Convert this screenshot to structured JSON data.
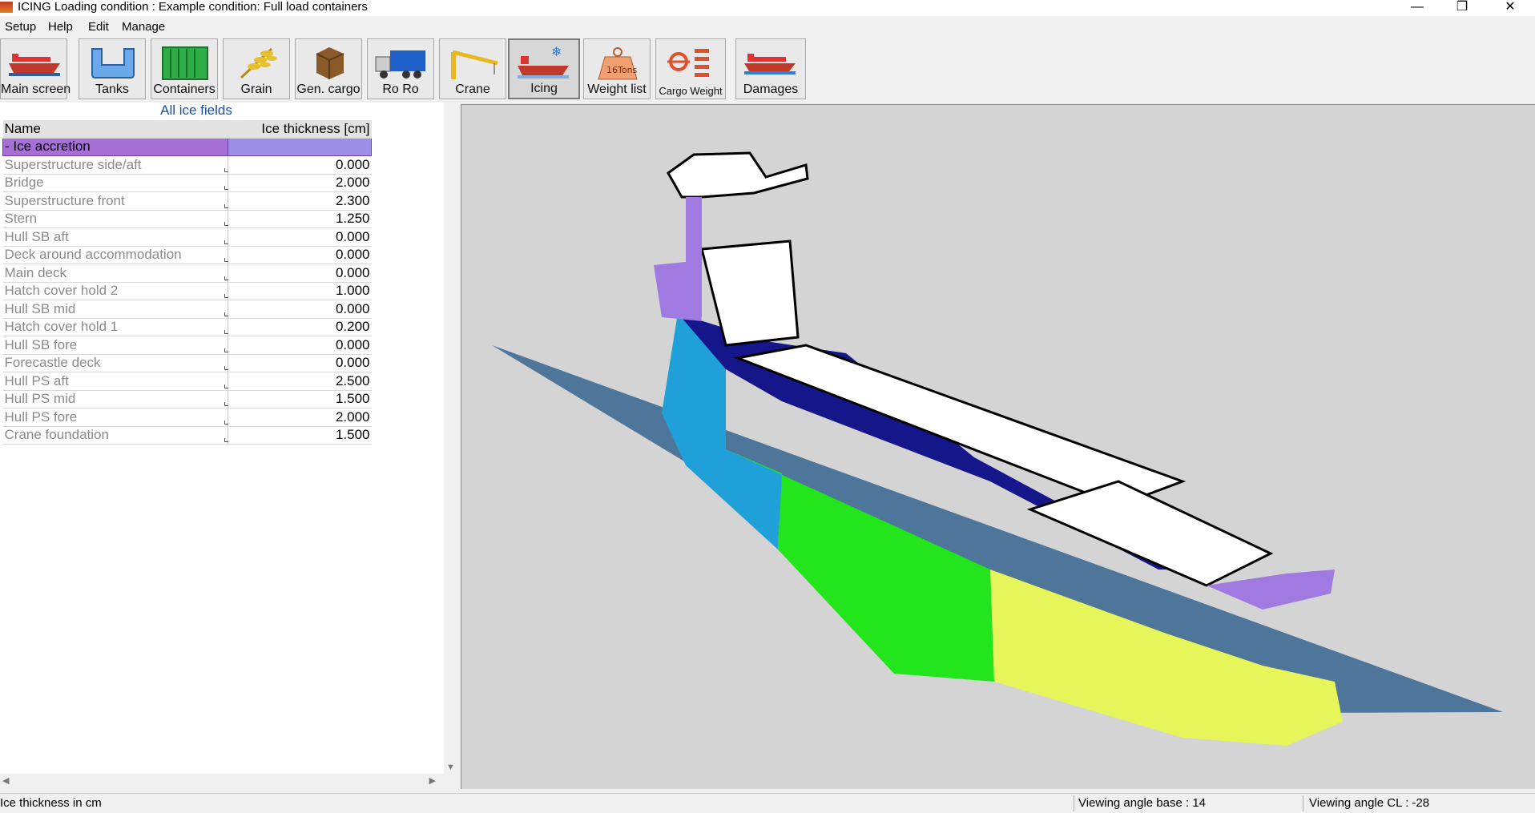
{
  "window": {
    "title": "ICING  Loading condition : Example condition: Full load containers"
  },
  "menu": [
    "Setup",
    "Help",
    "Edit",
    "Manage"
  ],
  "toolbar": [
    {
      "label": "Main screen",
      "icon": "ship-icon"
    },
    {
      "label": "Tanks",
      "icon": "tank-icon"
    },
    {
      "label": "Containers",
      "icon": "container-icon"
    },
    {
      "label": "Grain",
      "icon": "grain-icon"
    },
    {
      "label": "Gen. cargo",
      "icon": "cargo-box-icon"
    },
    {
      "label": "Ro Ro",
      "icon": "truck-icon"
    },
    {
      "label": "Crane",
      "icon": "crane-icon"
    },
    {
      "label": "Icing",
      "icon": "icing-ship-icon",
      "active": true
    },
    {
      "label": "Weight list",
      "icon": "weight-icon",
      "weight_text": "16Tons"
    },
    {
      "label": "Cargo Weight",
      "icon": "cargo-weight-icon"
    },
    {
      "label": "Damages",
      "icon": "damaged-ship-icon"
    }
  ],
  "panel": {
    "title": "All ice fields",
    "columns": [
      "Name",
      "Ice thickness [cm]"
    ],
    "group": "- Ice accretion",
    "rows": [
      {
        "name": "Superstructure side/aft",
        "value": "0.000"
      },
      {
        "name": "Bridge",
        "value": "2.000"
      },
      {
        "name": "Superstructure front",
        "value": "2.300"
      },
      {
        "name": "Stern",
        "value": "1.250"
      },
      {
        "name": "Hull SB aft",
        "value": "0.000"
      },
      {
        "name": "Deck around accommodation",
        "value": "0.000"
      },
      {
        "name": "Main deck",
        "value": "0.000"
      },
      {
        "name": "Hatch cover hold 2",
        "value": "1.000"
      },
      {
        "name": "Hull SB mid",
        "value": "0.000"
      },
      {
        "name": "Hatch cover hold 1",
        "value": "0.200"
      },
      {
        "name": "Hull SB fore",
        "value": "0.000"
      },
      {
        "name": "Forecastle deck",
        "value": "0.000"
      },
      {
        "name": "Hull PS aft",
        "value": "2.500"
      },
      {
        "name": "Hull PS mid",
        "value": "1.500"
      },
      {
        "name": "Hull PS fore",
        "value": "2.000"
      },
      {
        "name": "Crane foundation",
        "value": "1.500"
      }
    ]
  },
  "status": {
    "left": "Ice thickness in cm",
    "angle_base": "Viewing angle base : 14",
    "angle_cl": "Viewing angle CL : -28"
  },
  "colors": {
    "group_row": "#a56fd6",
    "water_plane": "#3f6a93",
    "hull_aft": "#1fa0d8",
    "hull_mid": "#22e51c",
    "hull_fore": "#e6f55a",
    "deck_dark": "#15168a",
    "superstructure_purple": "#a07ae0"
  }
}
